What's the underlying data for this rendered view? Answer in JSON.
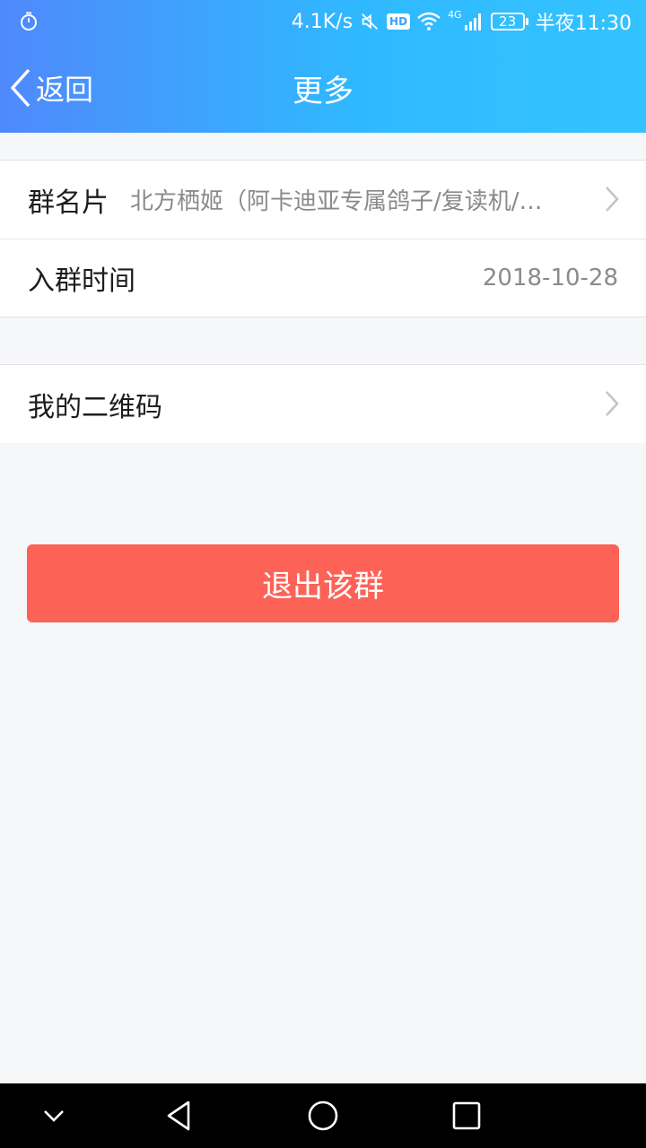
{
  "status_bar": {
    "net_speed": "4.1K/s",
    "hd_badge": "HD",
    "network": "4G",
    "battery": "23",
    "time": "半夜11:30"
  },
  "header": {
    "back_label": "返回",
    "title": "更多"
  },
  "info_group": [
    {
      "label": "群名片",
      "value": "北方栖姬（阿卡迪亚专属鸽子/复读机/…"
    },
    {
      "label": "入群时间",
      "value": "2018-10-28"
    }
  ],
  "qr_group": {
    "label": "我的二维码"
  },
  "exit_button": {
    "label": "退出该群"
  },
  "colors": {
    "header_gradient_start": "#4f89fb",
    "header_gradient_end": "#33c3ff",
    "exit_button": "#fd6257",
    "background": "#f6f7f9"
  },
  "icons": {
    "status_left": "stopwatch-icon",
    "mute": "muted-speaker-icon",
    "wifi": "wifi-icon",
    "signal": "signal-bars-icon",
    "back": "chevron-left-icon",
    "row_arrow": "chevron-right-icon",
    "nav_down": "chevron-down-icon",
    "nav_back": "triangle-back-icon",
    "nav_home": "circle-home-icon",
    "nav_recent": "square-recents-icon"
  }
}
